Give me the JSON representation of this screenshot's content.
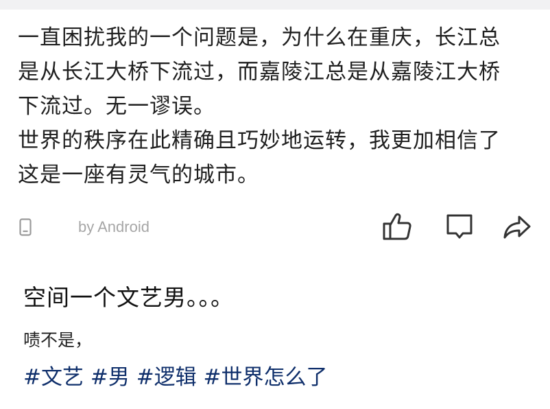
{
  "post": {
    "lines": [
      "一直困扰我的一个问题是，为什么在重庆，长江总",
      "是从长江大桥下流过，而嘉陵江总是从嘉陵江大桥",
      "下流过。无一谬误。",
      "世界的秩序在此精确且巧妙地运转，我更加相信了",
      "这是一座有灵气的城市。"
    ],
    "source": "by Android",
    "actions": {
      "like_icon": "thumbs-up-icon",
      "comment_icon": "comment-icon",
      "share_icon": "share-icon"
    },
    "device_icon": "phone-icon"
  },
  "caption": {
    "title": "空间一个文艺男。。。",
    "subtitle": "啧不是，",
    "hashtags": [
      "#文艺 ",
      "#男 ",
      "#逻辑 ",
      "#世界怎么了"
    ]
  },
  "colors": {
    "hashtag": "#0f2f6b",
    "muted": "#a6a6a6",
    "top_band": "#f1f1f3"
  }
}
